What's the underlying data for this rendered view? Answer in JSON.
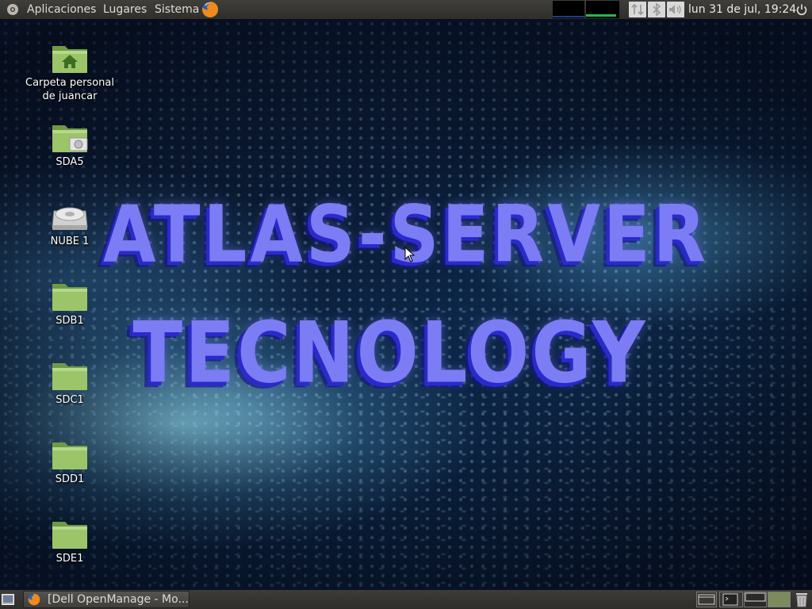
{
  "top_panel": {
    "menus": {
      "aplicaciones": "Aplicaciones",
      "lugares": "Lugares",
      "sistema": "Sistema"
    },
    "clock": "lun 31 de jul, 19:24",
    "icons": [
      "menu-logo-icon",
      "firefox-icon",
      "system-monitor",
      "network-icon",
      "bluetooth-icon",
      "volume-icon",
      "power-icon"
    ]
  },
  "desktop": {
    "icons": [
      {
        "label_line1": "Carpeta personal",
        "label_line2": "de juancar",
        "icon": "home-folder-icon"
      },
      {
        "label": "SDA5",
        "icon": "drive-folder-icon"
      },
      {
        "label": "NUBE 1",
        "icon": "hard-drive-icon"
      },
      {
        "label": "SDB1",
        "icon": "folder-icon"
      },
      {
        "label": "SDC1",
        "icon": "folder-icon"
      },
      {
        "label": "SDD1",
        "icon": "folder-icon"
      },
      {
        "label": "SDE1",
        "icon": "folder-icon"
      }
    ],
    "wallpaper": {
      "line1": "ATLAS-SERVER",
      "line2": "TECNOLOGY",
      "text_color": "#7c7cf5"
    }
  },
  "bottom_panel": {
    "task": {
      "label": "[Dell OpenManage - Mo...",
      "icon": "firefox-icon"
    },
    "workspaces": 4,
    "icons": [
      "show-desktop-icon",
      "trash-icon"
    ]
  },
  "colors": {
    "panel": "#34332f",
    "folder_green": "#8fb35f",
    "wallpaper_base": "#0a1a33"
  }
}
